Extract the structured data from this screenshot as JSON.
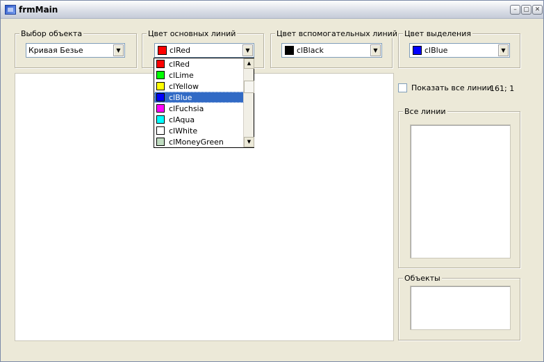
{
  "window": {
    "title": "frmMain",
    "min_glyph": "–",
    "max_glyph": "▢",
    "close_glyph": "✕"
  },
  "object_select": {
    "label": "Выбор объекта",
    "value": "Кривая Безье"
  },
  "main_line_color": {
    "label": "Цвет основных линий",
    "value": "clRed",
    "swatch": "#ff0000"
  },
  "aux_line_color": {
    "label": "Цвет вспомогательных линий",
    "value": "clBlack",
    "swatch": "#000000"
  },
  "selection_color": {
    "label": "Цвет выделения",
    "value": "clBlue",
    "swatch": "#0000ff"
  },
  "dropdown": {
    "items": [
      {
        "label": "clRed",
        "color": "#ff0000"
      },
      {
        "label": "clLime",
        "color": "#00ff00"
      },
      {
        "label": "clYellow",
        "color": "#ffff00"
      },
      {
        "label": "clBlue",
        "color": "#0000ff",
        "selected": true
      },
      {
        "label": "clFuchsia",
        "color": "#ff00ff"
      },
      {
        "label": "clAqua",
        "color": "#00ffff"
      },
      {
        "label": "clWhite",
        "color": "#ffffff"
      },
      {
        "label": "clMoneyGreen",
        "color": "#c0dcc0"
      }
    ],
    "scroll_up": "▲",
    "scroll_down": "▼"
  },
  "show_all_lines": {
    "label": "Показать все линии",
    "checked": false
  },
  "coords": "161; 1",
  "all_lines_group": {
    "label": "Все линии"
  },
  "objects_group": {
    "label": "Объекты"
  },
  "combo_arrow": "▼",
  "colors": {
    "selection_highlight": "#316ac5",
    "window_bg": "#ece9d8"
  }
}
